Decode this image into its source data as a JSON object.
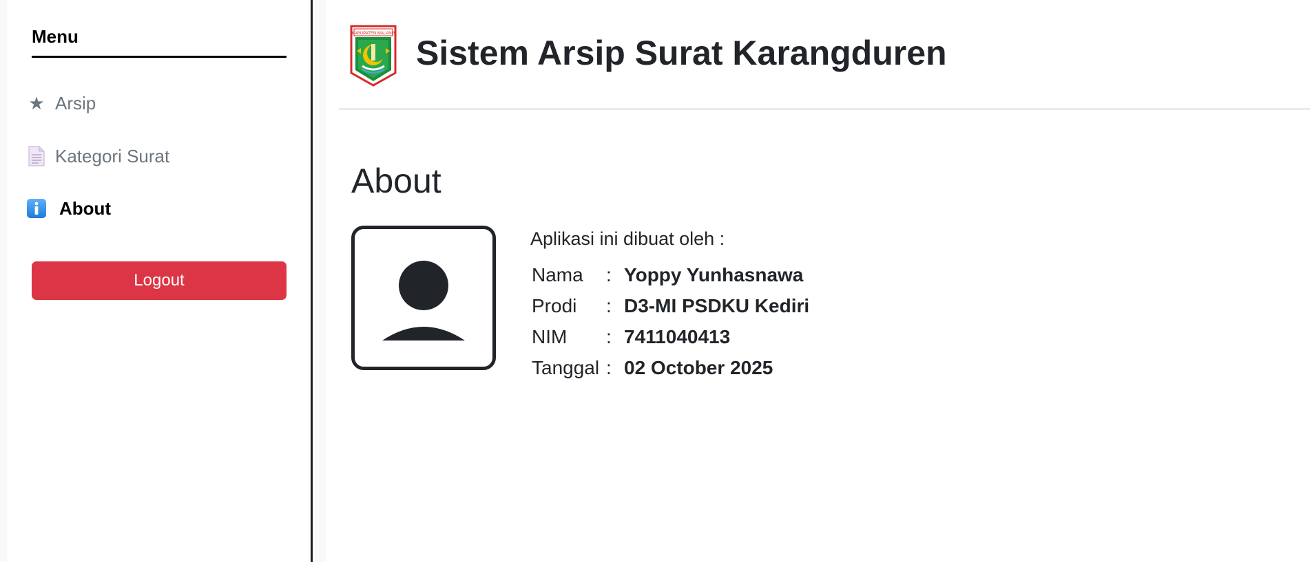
{
  "sidebar": {
    "heading": "Menu",
    "items": [
      {
        "label": "Arsip",
        "icon": "star-icon",
        "active": false
      },
      {
        "label": "Kategori Surat",
        "icon": "document-icon",
        "active": false
      },
      {
        "label": "About",
        "icon": "info-icon",
        "active": true
      }
    ],
    "logout_label": "Logout"
  },
  "header": {
    "title": "Sistem Arsip Surat Karangduren",
    "logo_icon": "kabupaten-malang-emblem",
    "logo_text": "KABUPATEN MALANG"
  },
  "main": {
    "page_title": "About",
    "avatar_icon": "user-avatar-icon",
    "intro": "Aplikasi ini dibuat oleh :",
    "details": [
      {
        "label": "Nama",
        "sep": ":",
        "value": "Yoppy Yunhasnawa"
      },
      {
        "label": "Prodi",
        "sep": ":",
        "value": "D3-MI PSDKU Kediri"
      },
      {
        "label": "NIM",
        "sep": ":",
        "value": "7411040413"
      },
      {
        "label": "Tanggal",
        "sep": ":",
        "value": "02 October 2025"
      }
    ]
  },
  "colors": {
    "logout": "#dc3545",
    "text": "#212529",
    "muted": "#6c757d",
    "info_icon": "#2f8fe6",
    "emblem_green": "#1a8f3c",
    "emblem_red": "#d52b2b",
    "emblem_gold": "#f2c300"
  }
}
